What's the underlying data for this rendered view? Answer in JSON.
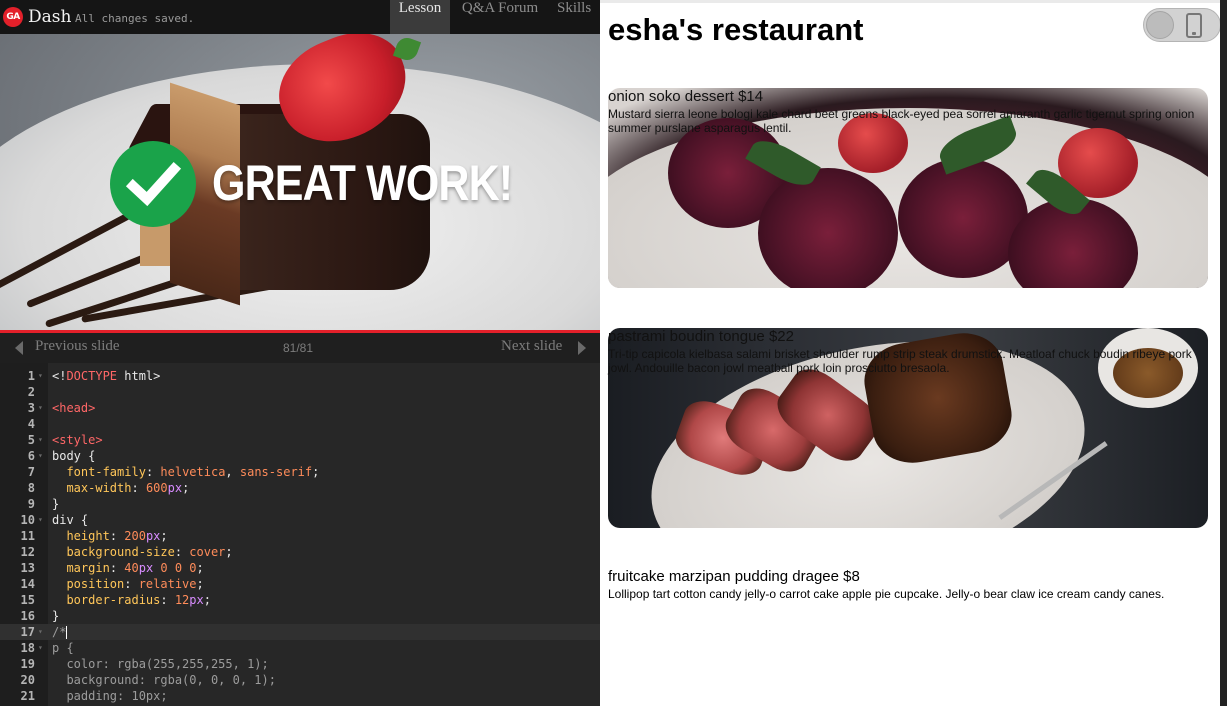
{
  "editor_app": {
    "logo_text": "GA",
    "name": "Dash",
    "save_status": "All changes saved.",
    "tabs": [
      {
        "label": "Lesson",
        "active": true
      },
      {
        "label": "Q&A Forum",
        "active": false
      },
      {
        "label": "Skills",
        "active": false
      }
    ]
  },
  "slide": {
    "message": "GREAT WORK!",
    "check_color": "#1aa34a",
    "progress_color": "#e3202a",
    "nav": {
      "prev_label": "Previous slide",
      "next_label": "Next slide",
      "count": "81/81"
    }
  },
  "code": [
    {
      "n": "1",
      "fold": true,
      "tokens": [
        [
          "plain",
          "<!"
        ],
        [
          "tag",
          "DOCTYPE"
        ],
        [
          "plain",
          " html>"
        ]
      ]
    },
    {
      "n": "2",
      "fold": false,
      "tokens": []
    },
    {
      "n": "3",
      "fold": true,
      "tokens": [
        [
          "tag",
          "<head>"
        ]
      ]
    },
    {
      "n": "4",
      "fold": false,
      "tokens": []
    },
    {
      "n": "5",
      "fold": true,
      "tokens": [
        [
          "tag",
          "<style>"
        ]
      ]
    },
    {
      "n": "6",
      "fold": true,
      "tokens": [
        [
          "plain",
          "body {"
        ]
      ]
    },
    {
      "n": "7",
      "fold": false,
      "tokens": [
        [
          "plain",
          "  "
        ],
        [
          "prop",
          "font-family"
        ],
        [
          "plain",
          ": "
        ],
        [
          "val",
          "helvetica"
        ],
        [
          "plain",
          ", "
        ],
        [
          "val",
          "sans-serif"
        ],
        [
          "plain",
          ";"
        ]
      ]
    },
    {
      "n": "8",
      "fold": false,
      "tokens": [
        [
          "plain",
          "  "
        ],
        [
          "prop",
          "max-width"
        ],
        [
          "plain",
          ": "
        ],
        [
          "val",
          "600"
        ],
        [
          "unit",
          "px"
        ],
        [
          "plain",
          ";"
        ]
      ]
    },
    {
      "n": "9",
      "fold": false,
      "tokens": [
        [
          "plain",
          "}"
        ]
      ]
    },
    {
      "n": "10",
      "fold": true,
      "tokens": [
        [
          "plain",
          "div {"
        ]
      ]
    },
    {
      "n": "11",
      "fold": false,
      "tokens": [
        [
          "plain",
          "  "
        ],
        [
          "prop",
          "height"
        ],
        [
          "plain",
          ": "
        ],
        [
          "val",
          "200"
        ],
        [
          "unit",
          "px"
        ],
        [
          "plain",
          ";"
        ]
      ]
    },
    {
      "n": "12",
      "fold": false,
      "tokens": [
        [
          "plain",
          "  "
        ],
        [
          "prop",
          "background-size"
        ],
        [
          "plain",
          ": "
        ],
        [
          "val",
          "cover"
        ],
        [
          "plain",
          ";"
        ]
      ]
    },
    {
      "n": "13",
      "fold": false,
      "tokens": [
        [
          "plain",
          "  "
        ],
        [
          "prop",
          "margin"
        ],
        [
          "plain",
          ": "
        ],
        [
          "val",
          "40"
        ],
        [
          "unit",
          "px"
        ],
        [
          "val",
          " 0 0 0"
        ],
        [
          "plain",
          ";"
        ]
      ]
    },
    {
      "n": "14",
      "fold": false,
      "tokens": [
        [
          "plain",
          "  "
        ],
        [
          "prop",
          "position"
        ],
        [
          "plain",
          ": "
        ],
        [
          "val",
          "relative"
        ],
        [
          "plain",
          ";"
        ]
      ]
    },
    {
      "n": "15",
      "fold": false,
      "tokens": [
        [
          "plain",
          "  "
        ],
        [
          "prop",
          "border-radius"
        ],
        [
          "plain",
          ": "
        ],
        [
          "val",
          "12"
        ],
        [
          "unit",
          "px"
        ],
        [
          "plain",
          ";"
        ]
      ]
    },
    {
      "n": "16",
      "fold": false,
      "tokens": [
        [
          "plain",
          "}"
        ]
      ]
    },
    {
      "n": "17",
      "fold": true,
      "active": true,
      "cursor": true,
      "tokens": [
        [
          "com",
          "/*"
        ]
      ]
    },
    {
      "n": "18",
      "fold": true,
      "tokens": [
        [
          "com",
          "p {"
        ]
      ]
    },
    {
      "n": "19",
      "fold": false,
      "tokens": [
        [
          "com",
          "  color: rgba(255,255,255, 1);"
        ]
      ]
    },
    {
      "n": "20",
      "fold": false,
      "tokens": [
        [
          "com",
          "  background: rgba(0, 0, 0, 1);"
        ]
      ]
    },
    {
      "n": "21",
      "fold": false,
      "tokens": [
        [
          "com",
          "  padding: 10px;"
        ]
      ]
    }
  ],
  "preview": {
    "title": "esha's restaurant",
    "toggle_icon": "phone-icon",
    "items": [
      {
        "title": "onion soko dessert $14",
        "desc": "Mustard sierra leone bologi kale chard beet greens black-eyed pea sorrel amaranth garlic tigernut spring onion summer purslane asparagus lentil."
      },
      {
        "title": "pastrami boudin tongue $22",
        "desc": "Tri-tip capicola kielbasa salami brisket shoulder rump strip steak drumstick. Meatloaf chuck boudin ribeye pork jowl. Andouille bacon jowl meatball pork loin prosciutto bresaola."
      },
      {
        "title": "fruitcake marzipan pudding dragee $8",
        "desc": "Lollipop tart cotton candy jelly-o carrot cake apple pie cupcake. Jelly-o bear claw ice cream candy canes."
      }
    ]
  }
}
